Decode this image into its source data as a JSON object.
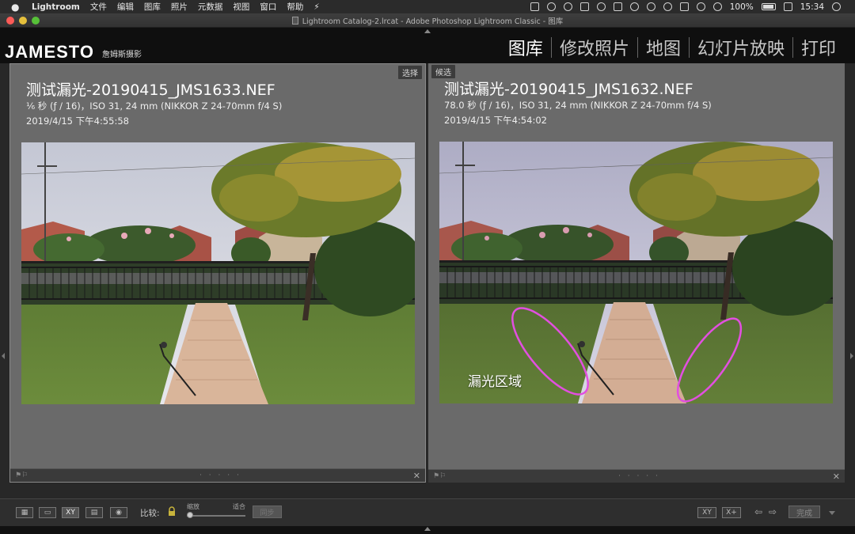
{
  "menubar": {
    "items": [
      "Lightroom",
      "文件",
      "编辑",
      "图库",
      "照片",
      "元数据",
      "视图",
      "窗口",
      "帮助"
    ],
    "battery": "100%",
    "clock": "15:34"
  },
  "window": {
    "title": "Lightroom Catalog-2.lrcat - Adobe Photoshop Lightroom Classic - 图库"
  },
  "identity": {
    "brand": "JAMESTO",
    "subtitle": "詹姆斯摄影"
  },
  "modules": [
    "图库",
    "修改照片",
    "地图",
    "幻灯片放映",
    "打印"
  ],
  "panes": [
    {
      "tag": "选择",
      "filename": "测试漏光-20190415_JMS1633.NEF",
      "exif": "⅙ 秒 (ƒ / 16)，ISO 31, 24 mm (NIKKOR Z 24-70mm f/4 S)",
      "date": "2019/4/15 下午4:55:58"
    },
    {
      "tag": "候选",
      "filename": "测试漏光-20190415_JMS1632.NEF",
      "exif": "78.0 秒 (ƒ / 16)，ISO 31, 24 mm (NIKKOR Z 24-70mm f/4 S)",
      "date": "2019/4/15 下午4:54:02",
      "annotation": "漏光区域"
    }
  ],
  "toolbar": {
    "compare_label": "比较:",
    "slider_min_label": "缩放",
    "slider_max_label": "适合",
    "sync_label": "同步",
    "done_label": "完成",
    "view_xy_label": "XY"
  },
  "colors": {
    "annotation": "#e24fe0",
    "pane_bg": "#6a6a6a",
    "app_bg": "#282828"
  }
}
